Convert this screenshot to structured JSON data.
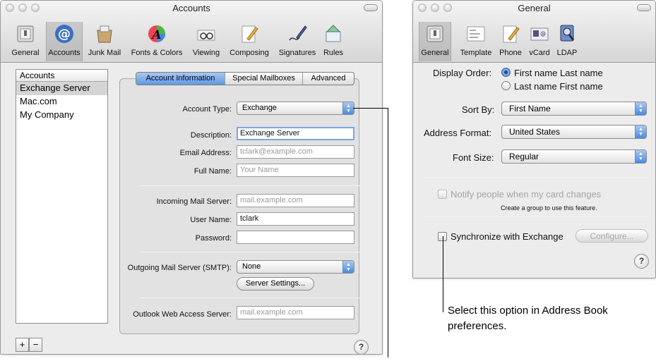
{
  "accounts_window": {
    "title": "Accounts",
    "toolbar": [
      {
        "label": "General",
        "icon": "general-switch-icon"
      },
      {
        "label": "Accounts",
        "icon": "at-sign-icon",
        "selected": true
      },
      {
        "label": "Junk Mail",
        "icon": "junk-mail-icon"
      },
      {
        "label": "Fonts & Colors",
        "icon": "fonts-colors-icon"
      },
      {
        "label": "Viewing",
        "icon": "glasses-icon"
      },
      {
        "label": "Composing",
        "icon": "composing-pencil-icon"
      },
      {
        "label": "Signatures",
        "icon": "signature-pen-icon"
      },
      {
        "label": "Rules",
        "icon": "rules-icon"
      }
    ],
    "account_list": {
      "header": "Accounts",
      "items": [
        "Exchange Server",
        "Mac.com",
        "My Company"
      ],
      "selected": "Exchange Server"
    },
    "tabs": [
      "Account Information",
      "Special Mailboxes",
      "Advanced"
    ],
    "active_tab": "Account Information",
    "fields": {
      "account_type_label": "Account Type:",
      "account_type_value": "Exchange",
      "description_label": "Description:",
      "description_value": "Exchange Server",
      "email_label": "Email Address:",
      "email_placeholder": "tclark@example.com",
      "fullname_label": "Full Name:",
      "fullname_placeholder": "Your Name",
      "incoming_label": "Incoming Mail Server:",
      "incoming_placeholder": "mail.example.com",
      "username_label": "User Name:",
      "username_value": "tclark",
      "password_label": "Password:",
      "password_value": "",
      "smtp_label": "Outgoing Mail Server (SMTP):",
      "smtp_value": "None",
      "server_settings_button": "Server Settings...",
      "owa_label": "Outlook Web Access Server:",
      "owa_placeholder": "mail.example.com"
    },
    "add_button": "+",
    "remove_button": "−",
    "help_button": "?"
  },
  "general_window": {
    "title": "General",
    "toolbar": [
      {
        "label": "General",
        "icon": "general-switch-icon",
        "selected": true
      },
      {
        "label": "Template",
        "icon": "template-card-icon"
      },
      {
        "label": "Phone",
        "icon": "phone-format-icon"
      },
      {
        "label": "vCard",
        "icon": "vcard-icon"
      },
      {
        "label": "LDAP",
        "icon": "ldap-search-icon"
      }
    ],
    "display_order_label": "Display Order:",
    "display_order_options": [
      "First name Last name",
      "Last name First name"
    ],
    "display_order_selected": "First name Last name",
    "sort_by_label": "Sort By:",
    "sort_by_value": "First Name",
    "address_format_label": "Address Format:",
    "address_format_value": "United States",
    "font_size_label": "Font Size:",
    "font_size_value": "Regular",
    "notify_label": "Notify people when my card changes",
    "notify_subtext": "Create a group to use this feature.",
    "sync_label": "Synchronize with Exchange",
    "configure_button": "Configure...",
    "help_button": "?"
  },
  "callout": "Select this option in Address Book preferences.",
  "colors": {
    "selection_blue": "#5e9ae2",
    "window_bg": "#ececec",
    "panel_bg": "#e2e2e2"
  }
}
